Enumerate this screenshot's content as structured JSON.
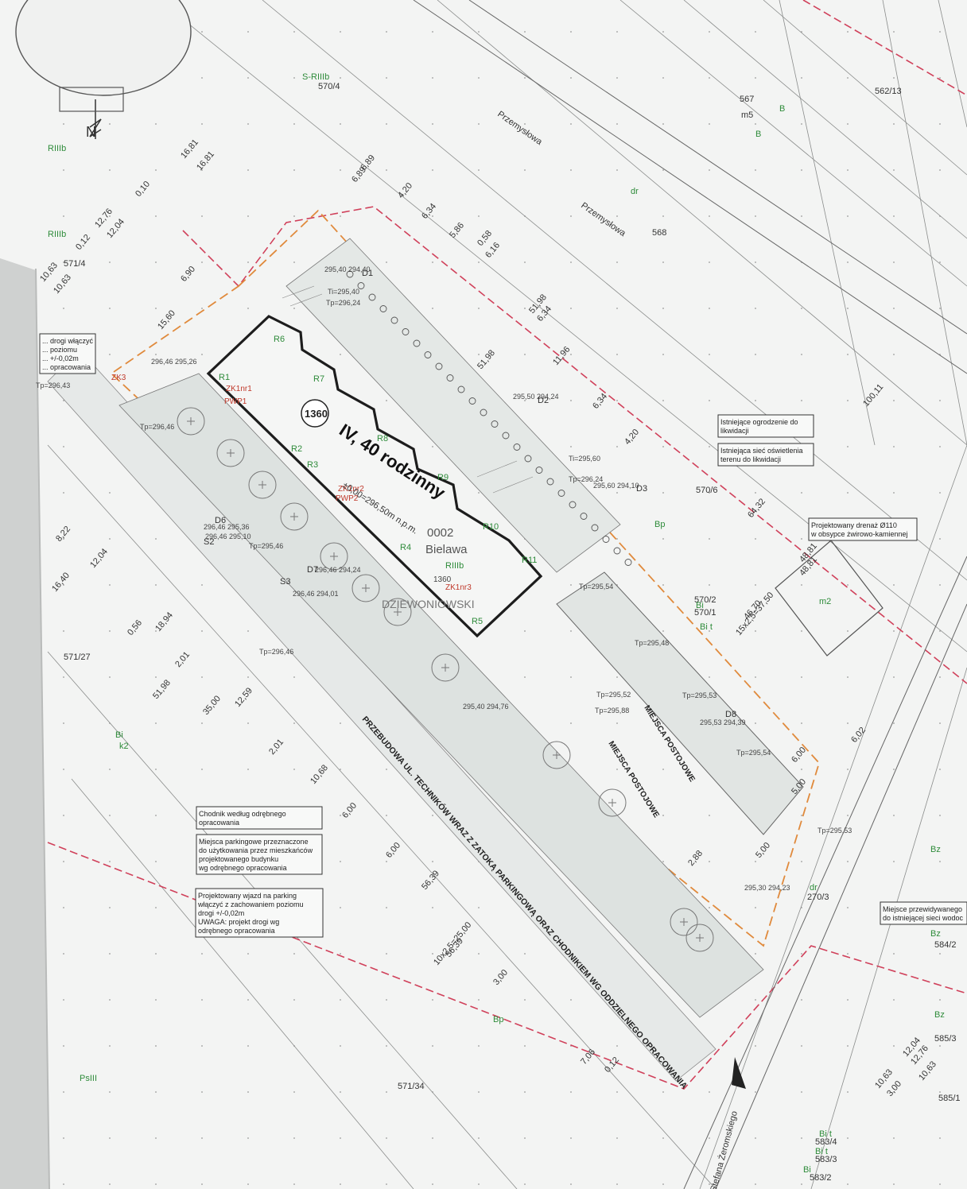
{
  "north_arrow": {
    "letter": "N"
  },
  "building": {
    "number": "1360",
    "title": "IV, 40 rodzinny",
    "level": "±0,00=296,50m n.p.m.",
    "district_code": "0002",
    "district_name": "Bielawa",
    "class": "RIIIb",
    "plot": "1360",
    "street": "DZIEWONIOWSKI"
  },
  "parcels": [
    "567",
    "m5",
    "562/13",
    "568",
    "570/4",
    "571/4",
    "571/27",
    "571/34",
    "570/6",
    "570/1",
    "570/2",
    "584/2",
    "585/3",
    "585/1",
    "583/4",
    "583/3",
    "583/2",
    "270/3"
  ],
  "land_classes": [
    "S-RIIIb",
    "RIIIb",
    "RIIIb",
    "B",
    "B",
    "Bi",
    "k2",
    "Bp",
    "Bp",
    "PsIII",
    "Bi",
    "Bi t",
    "Bz",
    "Bz",
    "Bz",
    "dr",
    "dr",
    "m2",
    "Bi t",
    "Bi t",
    "Bi"
  ],
  "streets": [
    "Przemysłowa",
    "Przemysłowa",
    "Stefana Żeromskiego"
  ],
  "points": {
    "R": [
      "R1",
      "R2",
      "R3",
      "R4",
      "R5",
      "R6",
      "R7",
      "R8",
      "R9",
      "R10",
      "R11"
    ],
    "D": [
      "D1",
      "D2",
      "D3",
      "D6",
      "D7",
      "D8"
    ],
    "S": [
      "S2",
      "S3"
    ],
    "other": [
      "ZK3",
      "ZK1nr1",
      "PWP1",
      "ZK1nr2",
      "PWP2",
      "ZK1nr3"
    ]
  },
  "levels": [
    "Tp=296,43",
    "Tp=296,46",
    "Tp=295,46",
    "Tp=296,46",
    "Ti=295,40",
    "Tp=296,24",
    "Ti=295,60",
    "Tp=296,24",
    "Tp=295,54",
    "Tp=295,48",
    "Tp=295,52",
    "Tp=295,88",
    "Tp=295,54",
    "Tp=295,53",
    "Tp=295,53",
    "295,40 294,40",
    "295,50 294,24",
    "295,60 294,10",
    "296,46 295,26",
    "296,46 295,36",
    "296,46 295,10",
    "296,46 294,24",
    "296,46 294,01",
    "295,40 294,76",
    "295,53 294,39",
    "295,30 294,23"
  ],
  "dimensions": [
    "6,89",
    "6,89",
    "4,20",
    "6,34",
    "5,86",
    "0,58",
    "6,16",
    "51,98",
    "6,34",
    "11,96",
    "51,98",
    "6,34",
    "4,20",
    "100,11",
    "64,32",
    "48,81",
    "48,81",
    "16,81",
    "16,81",
    "12,76",
    "12,04",
    "0,12",
    "0,10",
    "10,63",
    "10,63",
    "15,60",
    "6,90",
    "8,22",
    "12,04",
    "16,40",
    "18,94",
    "0,56",
    "51,98",
    "35,00",
    "12,59",
    "2,01",
    "2,01",
    "10,68",
    "6,00",
    "6,00",
    "56,39",
    "56,39",
    "10x2,5=25,00",
    "3,00",
    "7,06",
    "0,12",
    "12,04",
    "12,76",
    "10,63",
    "10,63",
    "3,00",
    "6,02",
    "6,00",
    "5,00",
    "2,88",
    "5,00",
    "46,70",
    "15x2,5=37,50"
  ],
  "road_label": "PRZEBUDOWA UL. TECHNIKÓW WRAZ Z ZATOKĄ PARKINGOWĄ ORAZ CHODNIKIEM WG ODDZIELNEGO OPRACOWANIA",
  "parking_labels": [
    "MIEJSCA POSTOJOWE",
    "MIEJSCA POSTOJOWE"
  ],
  "notes": [
    {
      "lines": [
        "Istniejące ogrodzenie do",
        "likwidacji"
      ]
    },
    {
      "lines": [
        "Istniejąca sieć oświetlenia",
        "terenu do likwidacji"
      ]
    },
    {
      "lines": [
        "Projektowany drenaż Ø110",
        "w obsypce żwirowo-kamiennej"
      ]
    },
    {
      "lines": [
        "Chodnik według odrębnego",
        "opracowania"
      ]
    },
    {
      "lines": [
        "Miejsca parkingowe przeznaczone",
        "do użytkowania przez mieszkańców",
        "projektowanego budynku",
        "wg odrębnego opracowania"
      ]
    },
    {
      "lines": [
        "Projektowany wjazd na parking",
        "włączyć z zachowaniem poziomu",
        "drogi +/-0,02m",
        "UWAGA: projekt drogi wg",
        "odrębnego opracowania"
      ]
    },
    {
      "lines": [
        "Miejsce przewidywanego",
        "do istniejącej sieci wodoc"
      ]
    },
    {
      "lines": [
        "... drogi włączyć",
        "... poziomu",
        "... +/-0,02m",
        "... opracowania"
      ]
    }
  ],
  "colors": {
    "paper": "#f4f5f4",
    "building": "#222222",
    "boundary_red": "#d0405a",
    "orange": "#e08a3c",
    "green": "#3a9a48",
    "blue": "#3b6fc4"
  }
}
